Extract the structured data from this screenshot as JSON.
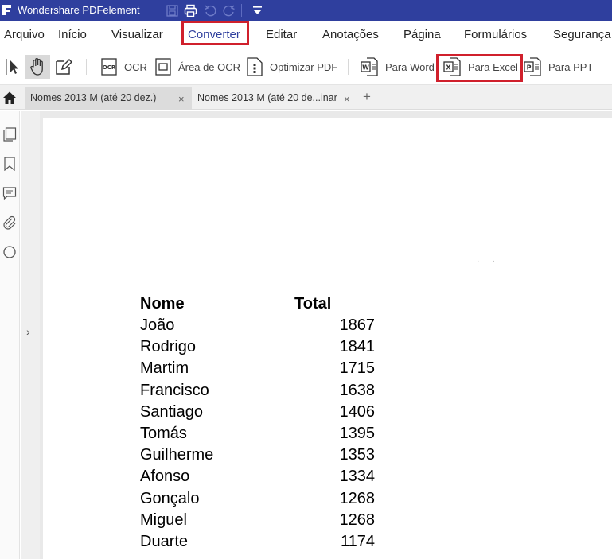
{
  "app": {
    "title": "Wondershare PDFelement",
    "brand_color": "#2f3f9e",
    "highlight_color": "#d0202c"
  },
  "quick_access": [
    {
      "name": "save-icon"
    },
    {
      "name": "print-icon"
    },
    {
      "name": "undo-icon"
    },
    {
      "name": "redo-icon"
    },
    {
      "name": "customize-dropdown-icon"
    }
  ],
  "menu": {
    "items": [
      "Arquivo",
      "Início",
      "Visualizar",
      "Converter",
      "Editar",
      "Anotações",
      "Página",
      "Formulários",
      "Segurança"
    ],
    "active": "Converter"
  },
  "toolbar": {
    "select_icon": "cursor-select-icon",
    "hand_icon": "hand-tool-icon",
    "edit_icon": "edit-icon",
    "ocr_label": "OCR",
    "area_ocr_label": "Área de OCR",
    "optimize_label": "Optimizar PDF",
    "to_word_label": "Para Word",
    "to_excel_label": "Para Excel",
    "to_ppt_label": "Para PPT"
  },
  "tabs": [
    {
      "label": "Nomes 2013 M (até 20 dez.)",
      "active": true
    },
    {
      "label": "Nomes 2013 M (até 20 de...inar",
      "active": false
    }
  ],
  "tabs_add": "+",
  "tabs_close": "×",
  "left_panel": {
    "icons": [
      "pages-icon",
      "bookmark-icon",
      "comment-icon",
      "attachment-icon",
      "search-icon"
    ],
    "expand": "›"
  },
  "document": {
    "headers": {
      "name": "Nome",
      "total": "Total"
    },
    "rows": [
      {
        "name": "João",
        "total": "1867"
      },
      {
        "name": "Rodrigo",
        "total": "1841"
      },
      {
        "name": "Martim",
        "total": "1715"
      },
      {
        "name": "Francisco",
        "total": "1638"
      },
      {
        "name": "Santiago",
        "total": "1406"
      },
      {
        "name": "Tomás",
        "total": "1395"
      },
      {
        "name": "Guilherme",
        "total": "1353"
      },
      {
        "name": "Afonso",
        "total": "1334"
      },
      {
        "name": "Gonçalo",
        "total": "1268"
      },
      {
        "name": "Miguel",
        "total": "1268"
      },
      {
        "name": "Duarte",
        "total": "1174"
      }
    ]
  }
}
